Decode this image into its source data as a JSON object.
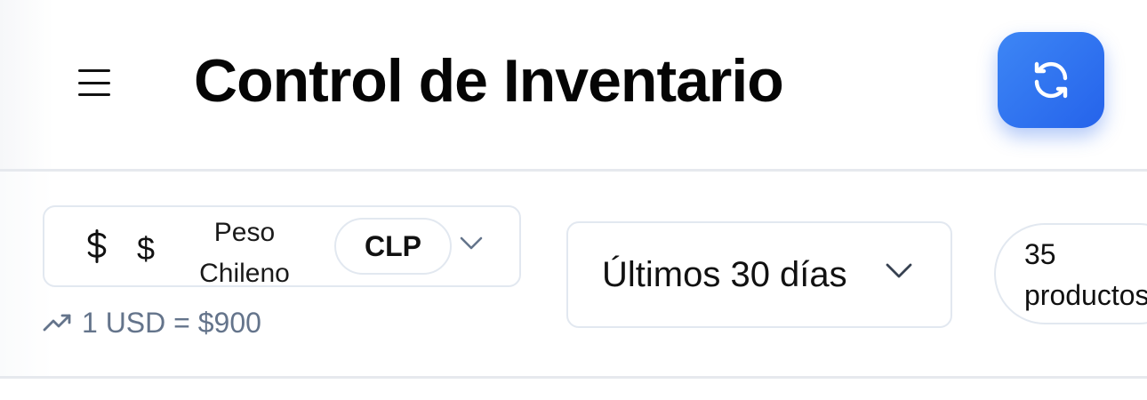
{
  "header": {
    "title": "Control de Inventario",
    "menu_icon": "menu-icon",
    "refresh_icon": "refresh-icon",
    "accent": "#2563eb"
  },
  "currency": {
    "icon": "dollar-icon",
    "symbol": "$",
    "name": "Peso Chileno",
    "code": "CLP",
    "rate_icon": "trending-up-icon",
    "rate_text": "1 USD = $900"
  },
  "period": {
    "label": "Últimos 30 días"
  },
  "products": {
    "count_label": "35 productos"
  }
}
